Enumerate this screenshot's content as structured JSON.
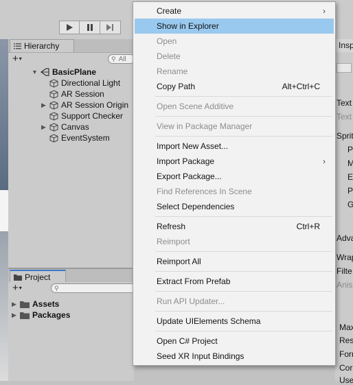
{
  "hierarchy": {
    "tab_label": "Hierarchy",
    "search_placeholder": "All",
    "items": [
      {
        "label": "BasicPlane"
      },
      {
        "label": "Directional Light"
      },
      {
        "label": "AR Session"
      },
      {
        "label": "AR Session Origin"
      },
      {
        "label": "Support Checker"
      },
      {
        "label": "Canvas"
      },
      {
        "label": "EventSystem"
      }
    ]
  },
  "project": {
    "tab_label": "Project",
    "folders": [
      {
        "label": "Assets"
      },
      {
        "label": "Packages"
      }
    ]
  },
  "inspector": {
    "tab_label": "Insp",
    "fragments": [
      "Text",
      "Text",
      "Sprit",
      "P",
      "M",
      "E",
      "P",
      "G",
      "Adva",
      "Wrap",
      "Filte",
      "Anis",
      "Max",
      "Res",
      "Forr",
      "Cor",
      "Use"
    ]
  },
  "context_menu": {
    "items": [
      {
        "label": "Create",
        "submenu": true
      },
      {
        "label": "Show in Explorer",
        "highlighted": true
      },
      {
        "label": "Open",
        "disabled": true
      },
      {
        "label": "Delete",
        "disabled": true
      },
      {
        "label": "Rename",
        "disabled": true
      },
      {
        "label": "Copy Path",
        "shortcut": "Alt+Ctrl+C"
      },
      {
        "label": "Open Scene Additive",
        "disabled": true
      },
      {
        "label": "View in Package Manager",
        "disabled": true
      },
      {
        "label": "Import New Asset..."
      },
      {
        "label": "Import Package",
        "submenu": true
      },
      {
        "label": "Export Package..."
      },
      {
        "label": "Find References In Scene",
        "disabled": true
      },
      {
        "label": "Select Dependencies"
      },
      {
        "label": "Refresh",
        "shortcut": "Ctrl+R"
      },
      {
        "label": "Reimport",
        "disabled": true
      },
      {
        "label": "Reimport All"
      },
      {
        "label": "Extract From Prefab"
      },
      {
        "label": "Run API Updater...",
        "disabled": true
      },
      {
        "label": "Update UIElements Schema"
      },
      {
        "label": "Open C# Project"
      },
      {
        "label": "Seed XR Input Bindings"
      }
    ],
    "submenu_glyph": "›"
  },
  "colors": {
    "menu_highlight": "#99c9ef",
    "disabled_text": "#8c8c8c",
    "project_tab_accent": "#3a78c8"
  }
}
